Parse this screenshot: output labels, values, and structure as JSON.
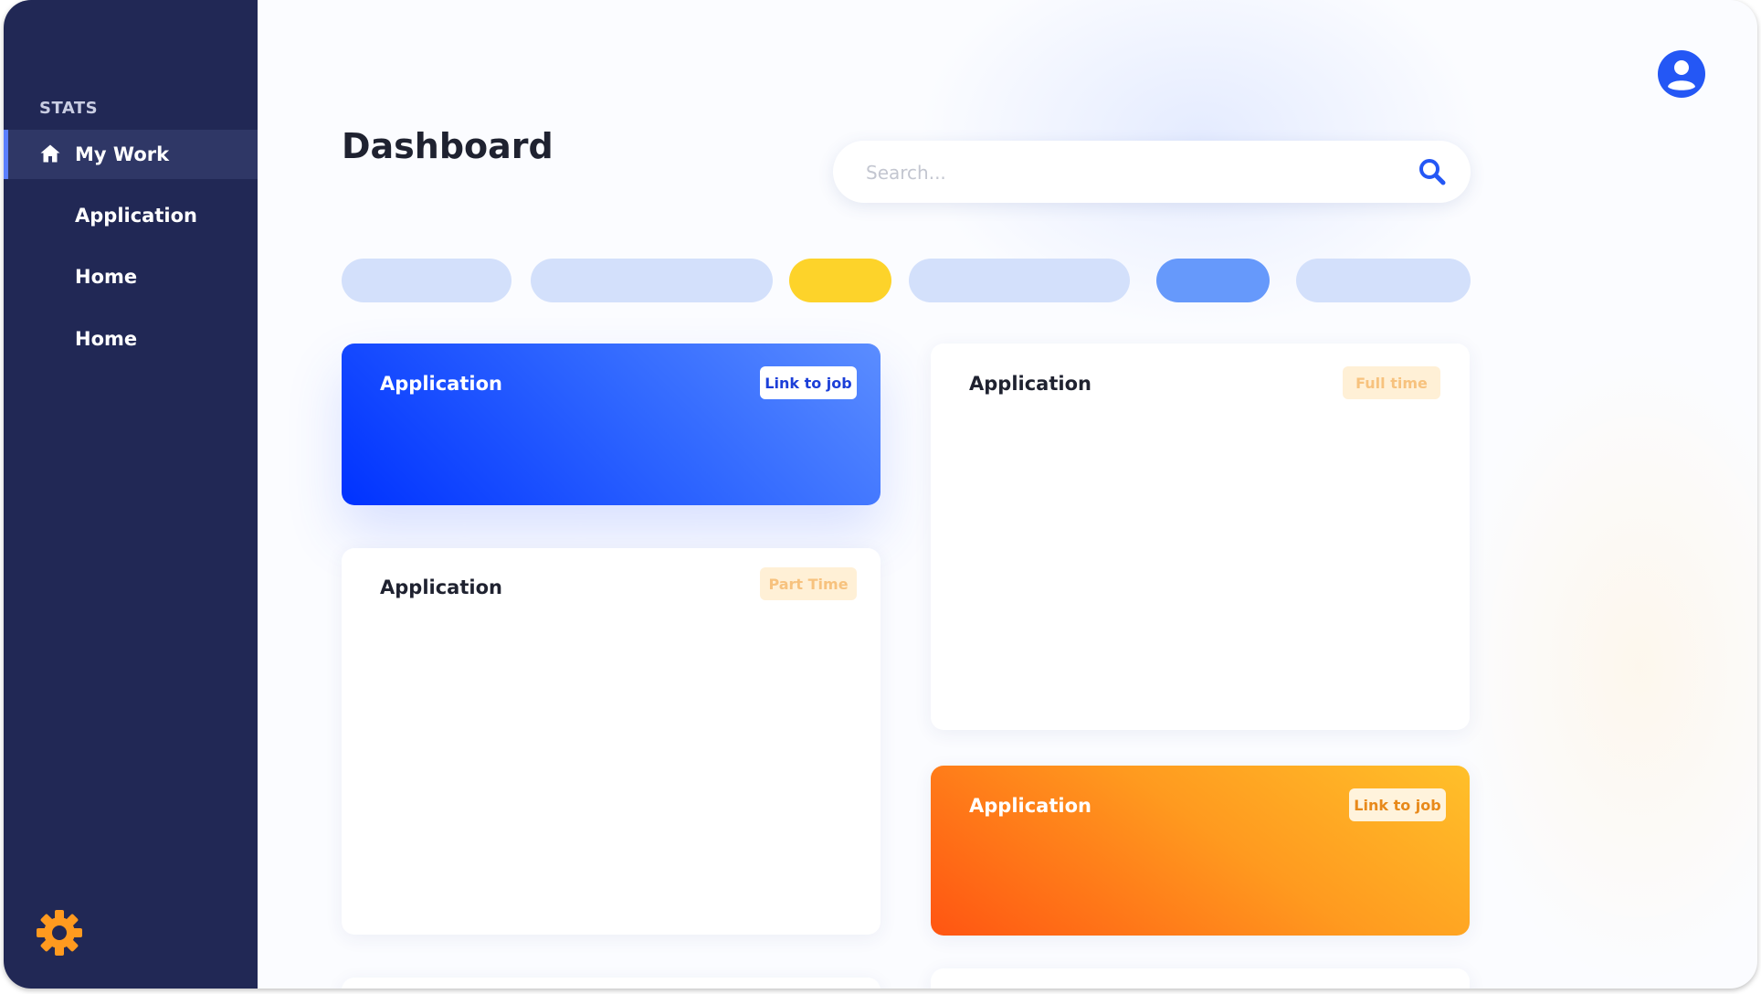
{
  "sidebar": {
    "section_label": "STATS",
    "items": [
      {
        "label": "My Work",
        "icon": "home-icon",
        "active": true
      },
      {
        "label": "Application"
      },
      {
        "label": "Home"
      },
      {
        "label": "Home"
      }
    ],
    "settings_icon": "gear-icon"
  },
  "header": {
    "title": "Dashboard",
    "search_placeholder": "Search...",
    "search_icon": "search-icon",
    "avatar_icon": "user-icon"
  },
  "filters": [
    {
      "state": "default"
    },
    {
      "state": "default"
    },
    {
      "state": "highlighted"
    },
    {
      "state": "default"
    },
    {
      "state": "selected"
    },
    {
      "state": "default"
    }
  ],
  "cards": [
    {
      "title": "Application",
      "tag": "Link to job",
      "style": "blue"
    },
    {
      "title": "Application",
      "tag": "Full time",
      "style": "white"
    },
    {
      "title": "Application",
      "tag": "Part Time",
      "style": "white"
    },
    {
      "title": "Application",
      "tag": "Link to job",
      "style": "orange"
    }
  ],
  "colors": {
    "sidebar": "#212855",
    "accent_blue": "#2f66ff",
    "accent_orange": "#ff8a1a",
    "pill": "#d3e0fb",
    "pill_selected": "#6699fb",
    "pill_highlight": "#fdd32a"
  }
}
